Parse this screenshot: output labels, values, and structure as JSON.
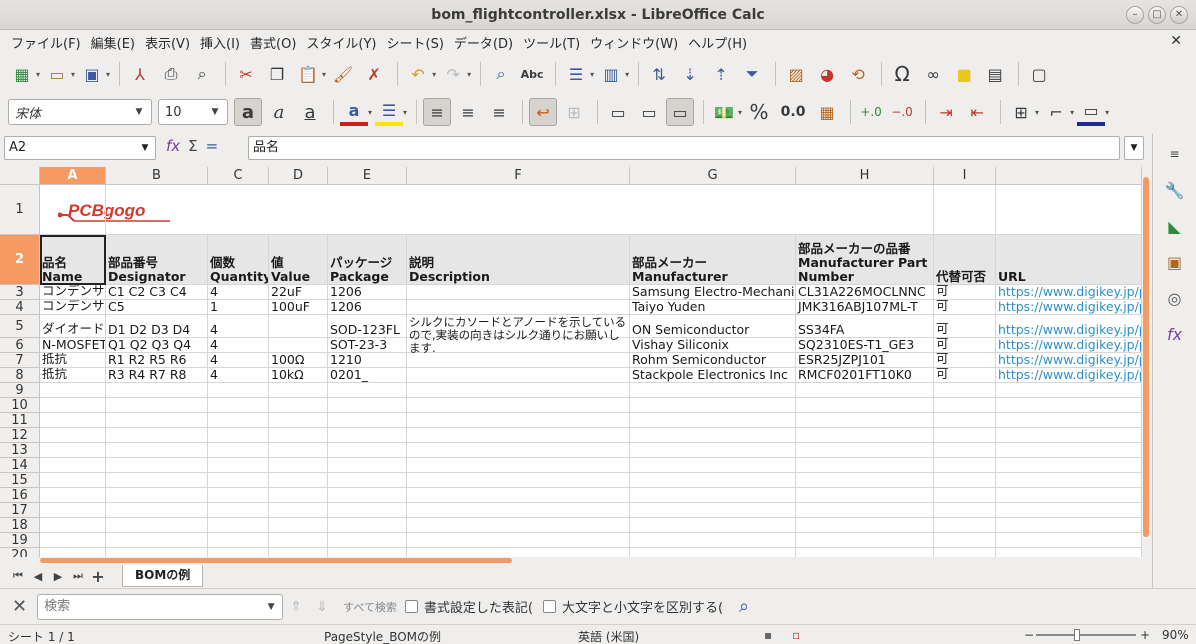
{
  "window": {
    "title": "bom_flightcontroller.xlsx - LibreOffice Calc"
  },
  "menu": [
    "ファイル(F)",
    "編集(E)",
    "表示(V)",
    "挿入(I)",
    "書式(O)",
    "スタイル(Y)",
    "シート(S)",
    "データ(D)",
    "ツール(T)",
    "ウィンドウ(W)",
    "ヘルプ(H)"
  ],
  "formatting": {
    "font_name": "宋体",
    "font_size": "10",
    "percent": "%",
    "decimal": "0.0"
  },
  "formula_bar": {
    "cell_ref": "A2",
    "content": "品名"
  },
  "columns": [
    {
      "id": "A",
      "w": 66
    },
    {
      "id": "B",
      "w": 102
    },
    {
      "id": "C",
      "w": 61
    },
    {
      "id": "D",
      "w": 59
    },
    {
      "id": "E",
      "w": 79
    },
    {
      "id": "F",
      "w": 223
    },
    {
      "id": "G",
      "w": 166
    },
    {
      "id": "H",
      "w": 138
    },
    {
      "id": "I",
      "w": 62
    },
    {
      "id": "J",
      "w": 146
    }
  ],
  "logo": {
    "text": "PCBgogo"
  },
  "header_row": [
    [
      "品名",
      "Name"
    ],
    [
      "部品番号",
      "Designator"
    ],
    [
      "個数",
      "Quantity"
    ],
    [
      "値",
      "Value"
    ],
    [
      "パッケージ",
      "Package"
    ],
    [
      "説明",
      "Description"
    ],
    [
      "部品メーカー",
      "Manufacturer"
    ],
    [
      "部品メーカーの品番",
      "Manufacturer Part Number"
    ],
    [
      "代替可否",
      ""
    ],
    [
      "URL",
      ""
    ]
  ],
  "rows": [
    [
      "コンデンサ",
      "C1 C2 C3 C4",
      "4",
      "22uF",
      "1206",
      "",
      "Samsung Electro-Mechanics",
      "CL31A226MOCLNNC",
      "可",
      "https://www.digikey.jp/pr"
    ],
    [
      "コンデンサ",
      "C5",
      "1",
      "100uF",
      "1206",
      "",
      "Taiyo Yuden",
      "JMK316ABJ107ML-T",
      "可",
      "https://www.digikey.jp/pr"
    ],
    [
      "ダイオード",
      "D1 D2 D3 D4",
      "4",
      "",
      "SOD-123FL",
      "シルクにカソードとアノードを示しているので,実装の向きはシルク通りにお願いします.",
      "ON Semiconductor",
      "SS34FA",
      "可",
      "https://www.digikey.jp/pr"
    ],
    [
      "N-MOSFET",
      "Q1 Q2 Q3 Q4",
      "4",
      "",
      "SOT-23-3",
      "",
      "Vishay Siliconix",
      "SQ2310ES-T1_GE3",
      "可",
      "https://www.digikey.jp/pr"
    ],
    [
      "抵抗",
      "R1 R2 R5 R6",
      "4",
      "100Ω",
      "1210",
      "",
      "Rohm Semiconductor",
      "ESR25JZPJ101",
      "可",
      "https://www.digikey.jp/pr"
    ],
    [
      "抵抗",
      "R3 R4 R7 R8",
      "4",
      "10kΩ",
      "0201_",
      "",
      "Stackpole Electronics Inc",
      "RMCF0201FT10K0",
      "可",
      "https://www.digikey.jp/pr"
    ]
  ],
  "row_numbers": [
    "1",
    "2",
    "3",
    "4",
    "5",
    "6",
    "7",
    "8",
    "9",
    "10",
    "11",
    "12",
    "13",
    "14",
    "15",
    "16",
    "17",
    "18",
    "19",
    "20"
  ],
  "sheet_tab": "BOMの例",
  "find": {
    "placeholder": "検索",
    "find_all": "すべて検索",
    "formatted_display": "書式設定した表記(",
    "match_case": "大文字と小文字を区別する("
  },
  "status": {
    "sheet": "シート 1 / 1",
    "page_style": "PageStyle_BOMの例",
    "language": "英語 (米国)",
    "zoom_level": "90%",
    "zoom_minus": "−",
    "zoom_plus": "+"
  },
  "colors": {
    "accent": "#f59a63",
    "link": "#2c8fc9",
    "logo_red": "#d23a2c"
  }
}
